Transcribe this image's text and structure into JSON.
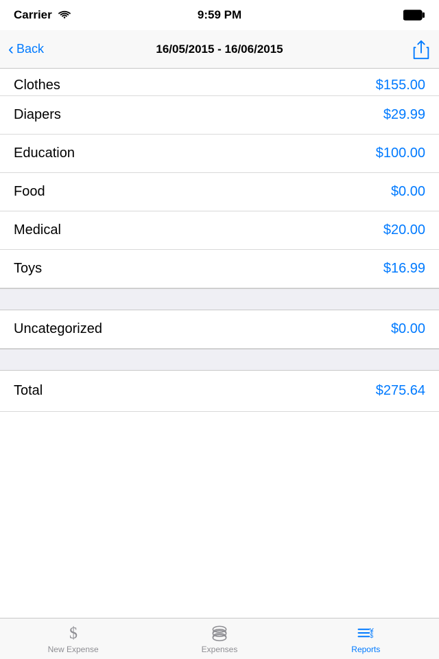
{
  "statusBar": {
    "carrier": "Carrier",
    "time": "9:59 PM"
  },
  "navBar": {
    "backLabel": "Back",
    "title": "16/05/2015 - 16/06/2015"
  },
  "rows": [
    {
      "label": "Clothes",
      "value": "$155.00",
      "clipped": true
    },
    {
      "label": "Diapers",
      "value": "$29.99"
    },
    {
      "label": "Education",
      "value": "$100.00"
    },
    {
      "label": "Food",
      "value": "$0.00"
    },
    {
      "label": "Medical",
      "value": "$20.00"
    },
    {
      "label": "Toys",
      "value": "$16.99"
    }
  ],
  "uncategorized": {
    "label": "Uncategorized",
    "value": "$0.00"
  },
  "total": {
    "label": "Total",
    "value": "$275.64"
  },
  "tabBar": {
    "tabs": [
      {
        "label": "New Expense",
        "active": false,
        "icon": "dollar-icon"
      },
      {
        "label": "Expenses",
        "active": false,
        "icon": "expenses-icon"
      },
      {
        "label": "Reports",
        "active": true,
        "icon": "reports-icon"
      }
    ]
  }
}
